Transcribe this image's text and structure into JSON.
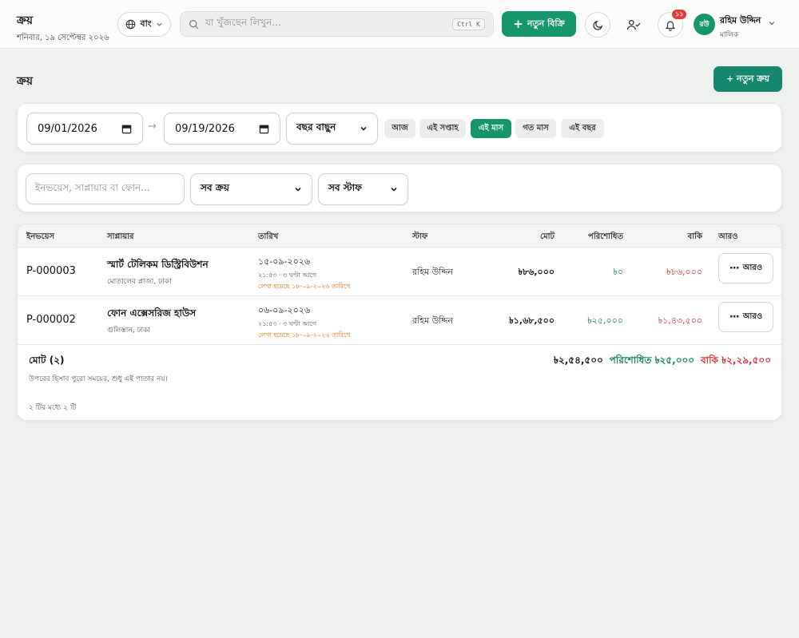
{
  "header": {
    "title": "ক্রয়",
    "date": "শনিবার, ১৯ সেপ্টেম্বর ২০২৬",
    "language_label": "বাং",
    "search_placeholder": "যা খুঁজছেন লিখুন...",
    "search_shortcut": "Ctrl K",
    "new_sale_label": "নতুন বিক্রি",
    "notification_count": "১১",
    "user_initials": "রউ",
    "user_name": "রহিম উদ্দিন",
    "user_role": "মালিক"
  },
  "page": {
    "title": "ক্রয়",
    "new_purchase_label": "+ নতুন ক্রয়"
  },
  "filters": {
    "date_from": "09/01/2026",
    "date_to": "09/19/2026",
    "date_separator": "→",
    "year_select": "বছর বাছুন",
    "quick_ranges": [
      {
        "label": "আজ",
        "active": false
      },
      {
        "label": "এই সপ্তাহ",
        "active": false
      },
      {
        "label": "এই মাস",
        "active": true
      },
      {
        "label": "গত মাস",
        "active": false
      },
      {
        "label": "এই বছর",
        "active": false
      }
    ],
    "search_placeholder": "ইনভয়েস, সাপ্লায়ার বা ফোন...",
    "purchase_type_select": "সব ক্রয়",
    "staff_select": "সব স্টাফ"
  },
  "table": {
    "columns": [
      "ইনভয়েস",
      "সাপ্লায়ার",
      "তারিখ",
      "স্টাফ",
      "মোট",
      "পরিশোধিত",
      "বাকি",
      "আরও"
    ],
    "rows": [
      {
        "invoice": "P-000003",
        "supplier": "স্মার্ট টেলিকম ডিস্ট্রিবিউশন",
        "supplier_address": "মোতালেব প্লাজা, ঢাকা",
        "date": "১৫-০৯-২০২৬",
        "date_relative": "২১:৫৩ · ৩ ঘণ্টা আগে",
        "date_note": "লেখা হয়েছে ১৮-০৯-২০২৬ তারিখে",
        "staff": "রহিম উদ্দিন",
        "total": "৳৮৬,০০০",
        "paid": "৳০",
        "due": "৳৮৬,০০০",
        "more_label": "আরও"
      },
      {
        "invoice": "P-000002",
        "supplier": "ফোন এক্সেসরিজ হাউস",
        "supplier_address": "গুলিস্তান, ঢাকা",
        "date": "০৬-০৯-২০২৬",
        "date_relative": "২১:৫৩ · ৩ ঘণ্টা আগে",
        "date_note": "লেখা হয়েছে ১৮-০৯-২০২৬ তারিখে",
        "staff": "রহিম উদ্দিন",
        "total": "৳১,৬৮,৫০০",
        "paid": "৳২৫,০০০",
        "due": "৳১,৪৩,৫০০",
        "more_label": "আরও"
      }
    ],
    "summary": {
      "label": "মোট (২)",
      "note": "উপরের হিসাব পুরো সময়ের, শুধু এই পাতার নয়।",
      "total": "৳২,৫৪,৫০০",
      "paid": "পরিশোধিত ৳২৫,০০০",
      "due": "বাকি ৳২,২৯,৫০০"
    },
    "pagination": "২ টির মধ্যে ২ টি"
  },
  "colors": {
    "brand": "#16956c",
    "paid": "#16864f",
    "due": "#d53434",
    "note": "#d97014"
  }
}
